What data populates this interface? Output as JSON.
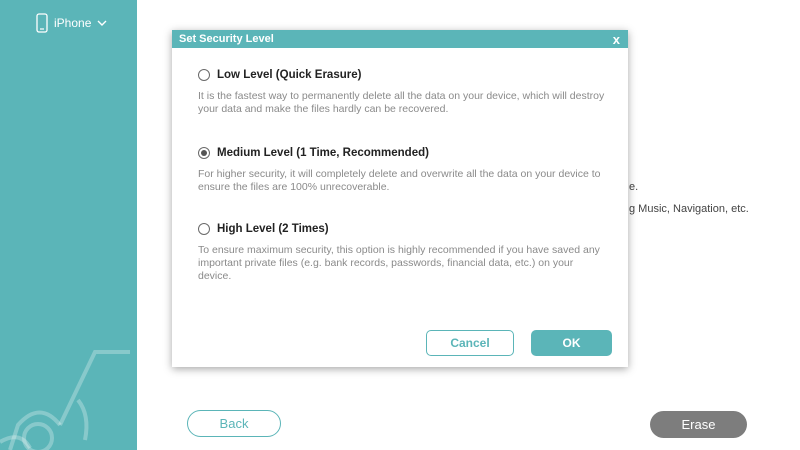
{
  "sidebar": {
    "device_label": "iPhone",
    "device_icon": "phone-icon",
    "dropdown_icon": "chevron-down-icon"
  },
  "background": {
    "text_fragment_1": "e.",
    "text_fragment_2": "g Music, Navigation, etc."
  },
  "footer": {
    "back_label": "Back",
    "erase_label": "Erase"
  },
  "dialog": {
    "title": "Set Security Level",
    "close_label": "x",
    "options": [
      {
        "title": "Low Level (Quick Erasure)",
        "description": "It is the fastest way to permanently delete all the data on your device, which will destroy your data and make the files hardly can be recovered.",
        "selected": false
      },
      {
        "title": "Medium Level (1 Time, Recommended)",
        "description": "For higher security, it will completely delete and overwrite all the data on your device to ensure the files are 100% unrecoverable.",
        "selected": true
      },
      {
        "title": "High Level (2 Times)",
        "description": "To ensure maximum security, this option is highly recommended if you have saved any important private files (e.g. bank records, passwords, financial data, etc.) on your device.",
        "selected": false
      }
    ],
    "cancel_label": "Cancel",
    "ok_label": "OK"
  },
  "colors": {
    "accent": "#5bb5b8",
    "erase_button": "#7d7d7d"
  }
}
